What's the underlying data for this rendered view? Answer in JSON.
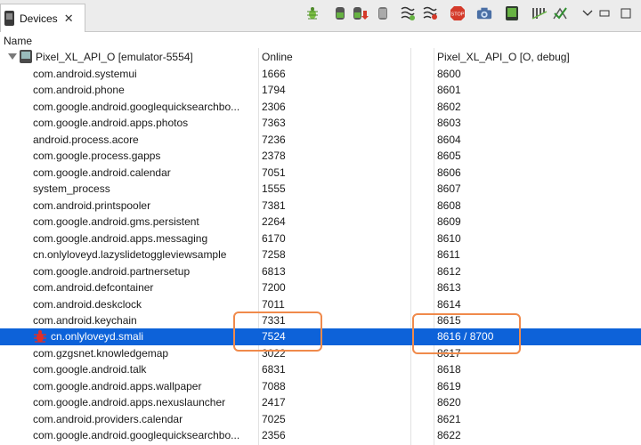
{
  "tab": {
    "title": "Devices",
    "close": "✕"
  },
  "toolbar": {
    "icons": [
      "debug-bug-icon",
      "update-heap-icon",
      "dump-hprof-icon",
      "cause-gc-icon",
      "update-threads-icon",
      "start-method-profiling-icon",
      "stop-process-icon",
      "screen-capture-icon",
      "dump-view-hierarchy-icon",
      "systrace-icon",
      "opengl-trace-icon",
      "view-menu-icon",
      "minimize-icon",
      "maximize-icon"
    ]
  },
  "header": {
    "name": "Name"
  },
  "device": {
    "name": "Pixel_XL_API_O [emulator-5554]",
    "status": "Online",
    "target": "Pixel_XL_API_O [O, debug]"
  },
  "processes": [
    {
      "name": "com.android.systemui",
      "pid": "1666",
      "port": "8600"
    },
    {
      "name": "com.android.phone",
      "pid": "1794",
      "port": "8601"
    },
    {
      "name": "com.google.android.googlequicksearchbo...",
      "pid": "2306",
      "port": "8602"
    },
    {
      "name": "com.google.android.apps.photos",
      "pid": "7363",
      "port": "8603"
    },
    {
      "name": "android.process.acore",
      "pid": "7236",
      "port": "8604"
    },
    {
      "name": "com.google.process.gapps",
      "pid": "2378",
      "port": "8605"
    },
    {
      "name": "com.google.android.calendar",
      "pid": "7051",
      "port": "8606"
    },
    {
      "name": "system_process",
      "pid": "1555",
      "port": "8607"
    },
    {
      "name": "com.android.printspooler",
      "pid": "7381",
      "port": "8608"
    },
    {
      "name": "com.google.android.gms.persistent",
      "pid": "2264",
      "port": "8609"
    },
    {
      "name": "com.google.android.apps.messaging",
      "pid": "6170",
      "port": "8610"
    },
    {
      "name": "cn.onlyloveyd.lazyslidetoggleviewsample",
      "pid": "7258",
      "port": "8611"
    },
    {
      "name": "com.google.android.partnersetup",
      "pid": "6813",
      "port": "8612"
    },
    {
      "name": "com.android.defcontainer",
      "pid": "7200",
      "port": "8613"
    },
    {
      "name": "com.android.deskclock",
      "pid": "7011",
      "port": "8614"
    },
    {
      "name": "com.android.keychain",
      "pid": "7331",
      "port": "8615"
    },
    {
      "name": "cn.onlyloveyd.smali",
      "pid": "7524",
      "port": "8616 / 8700",
      "selected": true,
      "debug": true
    },
    {
      "name": "com.gzgsnet.knowledgemap",
      "pid": "3022",
      "port": "8617"
    },
    {
      "name": "com.google.android.talk",
      "pid": "6831",
      "port": "8618"
    },
    {
      "name": "com.google.android.apps.wallpaper",
      "pid": "7088",
      "port": "8619"
    },
    {
      "name": "com.google.android.apps.nexuslauncher",
      "pid": "2417",
      "port": "8620"
    },
    {
      "name": "com.android.providers.calendar",
      "pid": "7025",
      "port": "8621"
    },
    {
      "name": "com.google.android.googlequicksearchbo...",
      "pid": "2356",
      "port": "8622"
    }
  ]
}
